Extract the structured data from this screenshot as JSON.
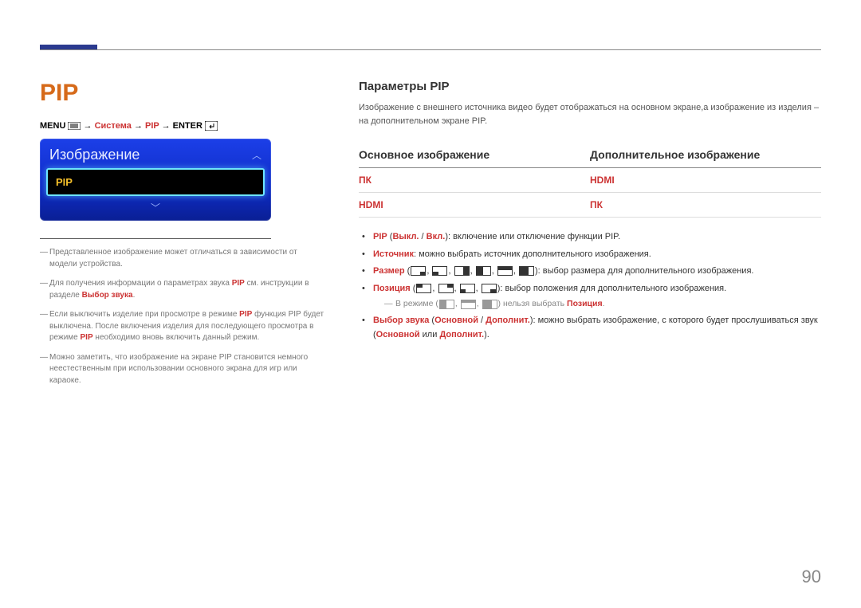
{
  "page_number": "90",
  "left": {
    "title": "PIP",
    "breadcrumb": {
      "menu": "MENU",
      "step1": "Система",
      "step2": "PIP",
      "enter": "ENTER"
    },
    "osd": {
      "heading": "Изображение",
      "item": "PIP"
    },
    "notes": {
      "n1": "Представленное изображение может отличаться в зависимости от модели устройства.",
      "n2a": "Для получения информации о параметрах звука ",
      "n2b": "PIP",
      "n2c": " см. инструкции в разделе ",
      "n2d": "Выбор звука",
      "n2e": ".",
      "n3a": "Если выключить изделие при просмотре в режиме ",
      "n3b": "PIP",
      "n3c": " функция PIP будет выключена. После включения изделия для последующего просмотра в режиме ",
      "n3d": "PIP",
      "n3e": " необходимо вновь включить данный режим.",
      "n4": "Можно заметить, что изображение на экране PIP становится немного неестественным при использовании основного экрана для игр или караоке."
    }
  },
  "right": {
    "section_title": "Параметры PIP",
    "intro": "Изображение с внешнего источника видео будет отображаться на основном экране,а изображение из изделия – на дополнительном экране PIP.",
    "table": {
      "head1": "Основное изображение",
      "head2": "Дополнительное изображение",
      "r1c1": "ПК",
      "r1c2": "HDMI",
      "r2c1": "HDMI",
      "r2c2": "ПК"
    },
    "bullets": {
      "b1_label": "PIP",
      "b1_paren": " (",
      "b1_off": "Выкл.",
      "b1_slash": " / ",
      "b1_on": "Вкл.",
      "b1_rest": "): включение или отключение функции PIP.",
      "b2_label": "Источник",
      "b2_rest": ": можно выбрать источник дополнительного изображения.",
      "b3_label": "Размер",
      "b3_rest": "): выбор размера для дополнительного изображения.",
      "b4_label": "Позиция",
      "b4_rest": "): выбор положения для дополнительного изображения.",
      "b4_sub_a": "В режиме (",
      "b4_sub_b": ")  нельзя выбрать ",
      "b4_sub_c": "Позиция",
      "b4_sub_d": ".",
      "b5_label": "Выбор звука",
      "b5_p1": " (",
      "b5_main": "Основной",
      "b5_slash": " / ",
      "b5_sec": "Дополнит.",
      "b5_rest1": "): можно выбрать изображение, с которого будет прослушиваться звук (",
      "b5_rest2": " или ",
      "b5_rest3": ")."
    }
  }
}
